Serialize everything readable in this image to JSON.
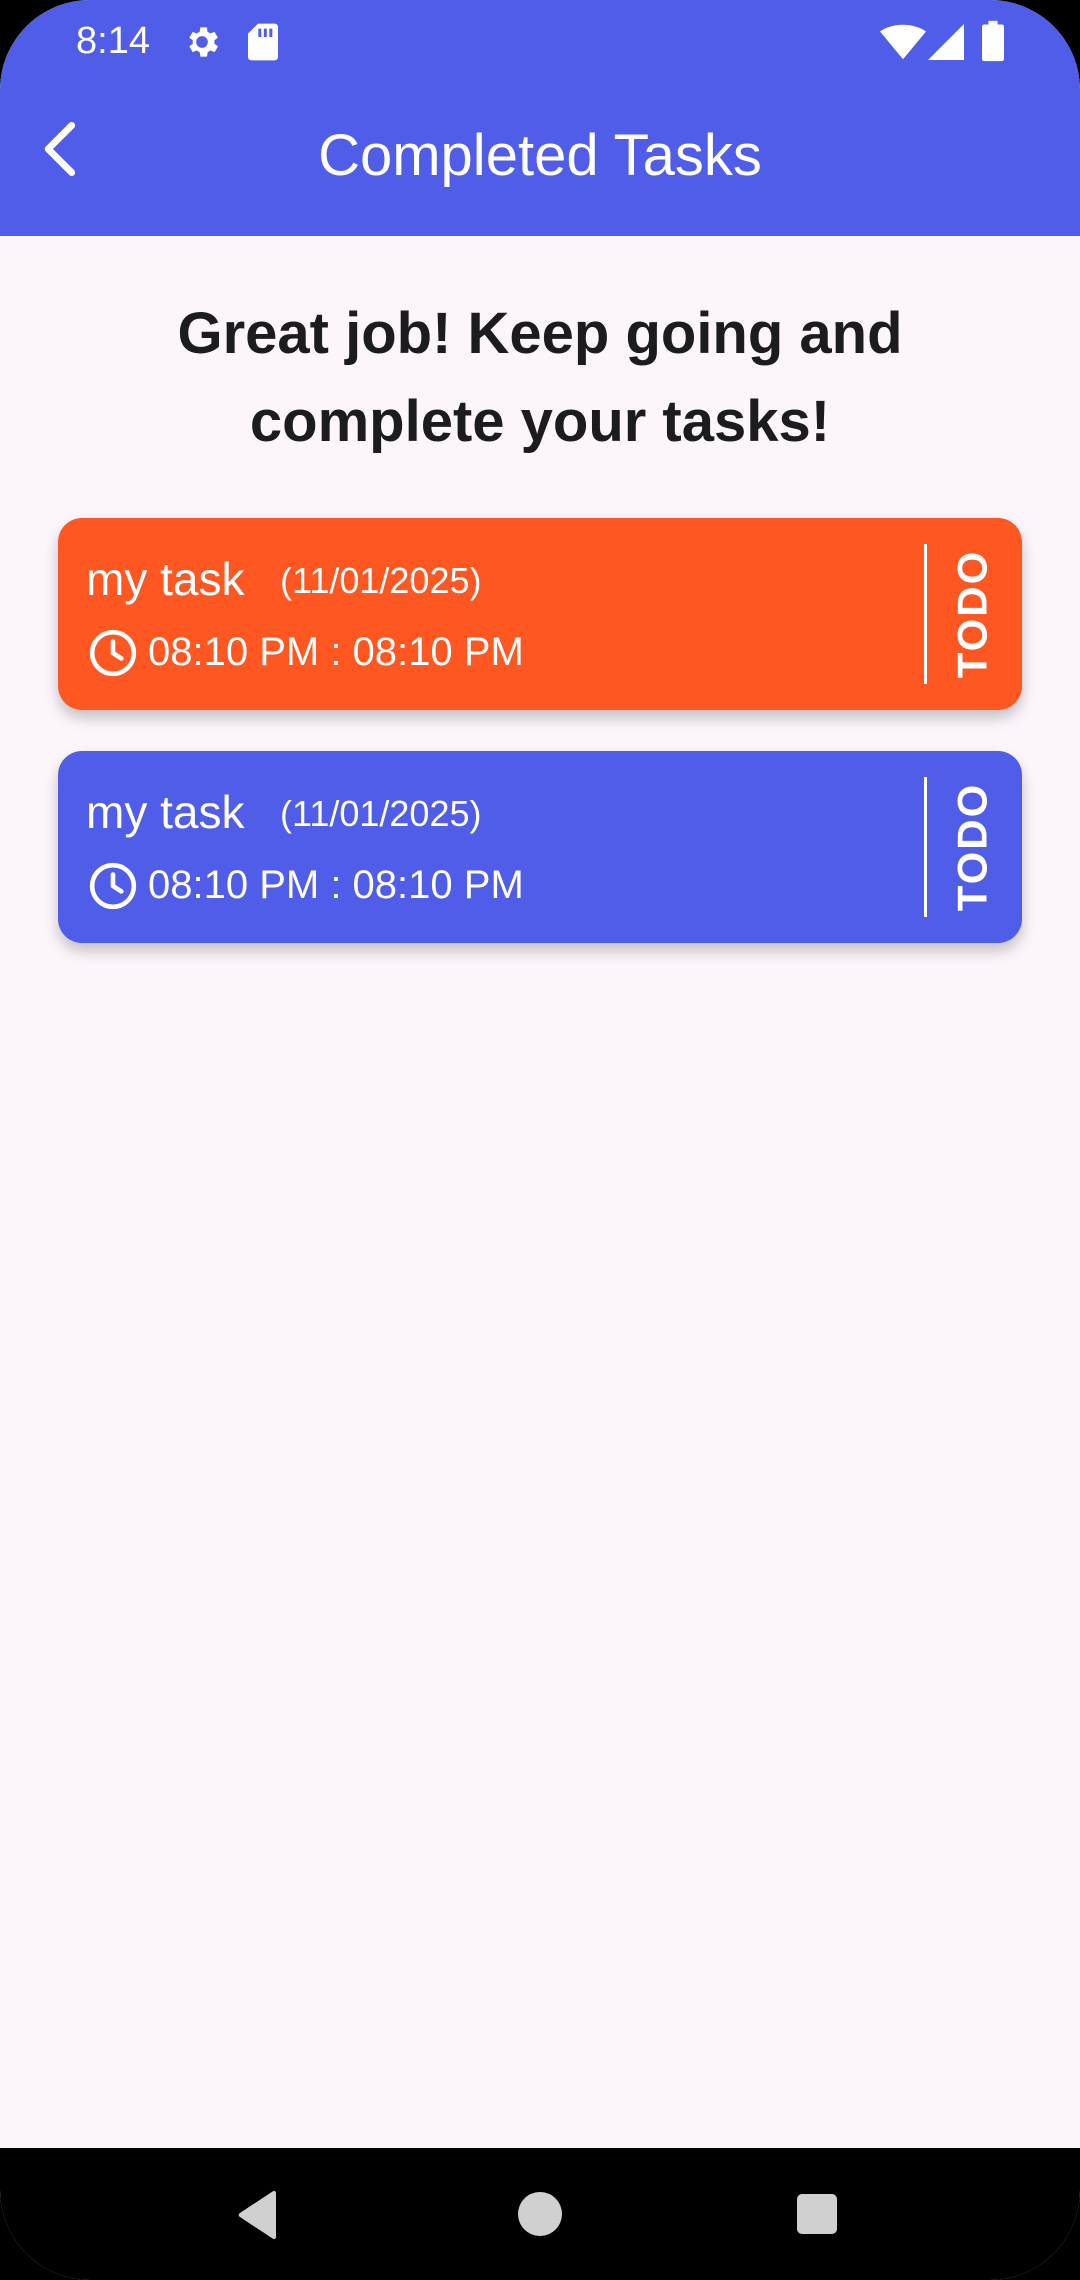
{
  "status_bar": {
    "time": "8:14",
    "icons": [
      "gear-icon",
      "sd-card-icon",
      "wifi-icon",
      "cellular-signal-icon",
      "battery-icon"
    ]
  },
  "app_bar": {
    "title": "Completed Tasks",
    "back_icon": "chevron-left-icon",
    "background_color": "#505DE8"
  },
  "headline": {
    "line1": "Great job! Keep going and",
    "line2": "complete your tasks!"
  },
  "tasks": [
    {
      "title": "my task",
      "date": "(11/01/2025)",
      "time": "08:10 PM : 08:10 PM",
      "status": "TODO",
      "color": "#FF5722"
    },
    {
      "title": "my task",
      "date": "(11/01/2025)",
      "time": "08:10 PM : 08:10 PM",
      "status": "TODO",
      "color": "#505DE8"
    }
  ],
  "nav_bar": {
    "buttons": [
      "back-triangle-icon",
      "home-circle-icon",
      "recents-square-icon"
    ]
  }
}
